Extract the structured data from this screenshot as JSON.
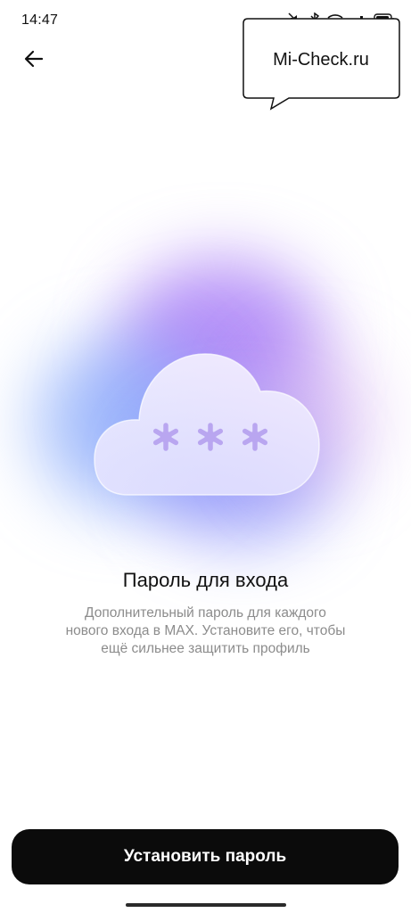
{
  "status_bar": {
    "time": "14:47",
    "icons": [
      "mute-icon",
      "bluetooth-icon",
      "wifi-icon",
      "cellular-icon",
      "battery-icon"
    ]
  },
  "watermark": {
    "text": "Mi-Check.ru"
  },
  "header": {
    "back_icon": "arrow-left-icon"
  },
  "main": {
    "illustration": "cloud-password-icon",
    "title": "Пароль для входа",
    "description": "Дополнительный пароль для каждого нового входа в MAX. Установите его, чтобы ещё сильнее защитить профиль"
  },
  "footer": {
    "set_password_label": "Установить пароль"
  },
  "colors": {
    "button_bg": "#0b0b0b",
    "button_text": "#ffffff",
    "description_text": "#8c8c8c",
    "glow_purple": "#a778f5",
    "glow_blue": "#78a0fa"
  }
}
